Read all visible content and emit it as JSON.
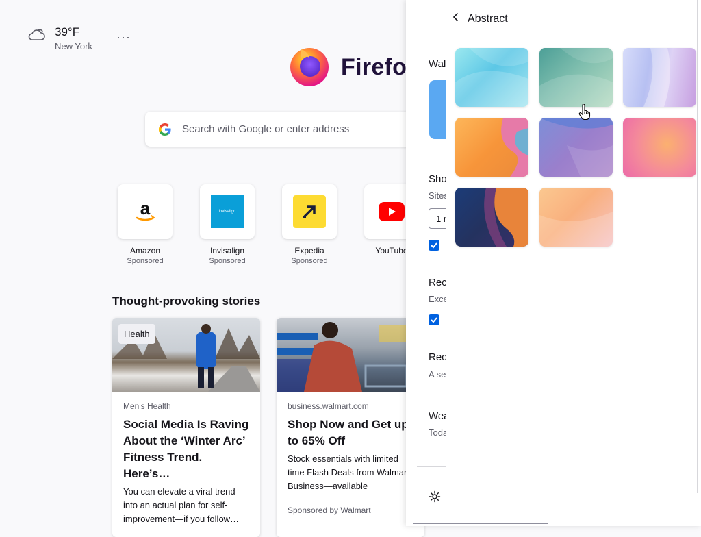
{
  "weather": {
    "temp": "39°F",
    "city": "New York",
    "menu": "···"
  },
  "brand": {
    "name": "Firefox"
  },
  "search": {
    "placeholder": "Search with Google or enter address"
  },
  "shortcuts": [
    {
      "name": "Amazon",
      "label": "Sponsored"
    },
    {
      "name": "Invisalign",
      "label": "Sponsored"
    },
    {
      "name": "Expedia",
      "label": "Sponsored"
    },
    {
      "name": "YouTube",
      "label": ""
    }
  ],
  "stories": {
    "heading": "Thought-provoking stories",
    "cards": [
      {
        "tag": "Health",
        "source": "Men's Health",
        "title": "Social Media Is Raving About the ‘Winter Arc’ Fitness Trend. Here’s…",
        "excerpt": "You can elevate a viral trend into an actual plan for self-improvement—if you follow…"
      },
      {
        "source": "business.walmart.com",
        "title": "Shop Now and Get up to 65% Off",
        "excerpt": "Stock essentials with limited time Flash Deals from Walmart Business—available",
        "sponsor": "Sponsored by Walmart"
      }
    ]
  },
  "panel": {
    "wallpapers": "Wal",
    "shortcuts": "Sho",
    "sites": "Sites",
    "rows_value": "1 r",
    "recommended": "Rec",
    "recommended_sub": "Exce",
    "recent": "Rec",
    "recent_sub": "A se",
    "weather": "Wea",
    "weather_sub": "Toda"
  },
  "subpanel": {
    "back_label": "Abstract",
    "swatches": [
      "abstract-cyan",
      "abstract-teal",
      "abstract-lavender",
      "abstract-orange-pink",
      "abstract-purple-blue",
      "abstract-pink-orange",
      "abstract-navy-orange",
      "abstract-peach"
    ]
  }
}
